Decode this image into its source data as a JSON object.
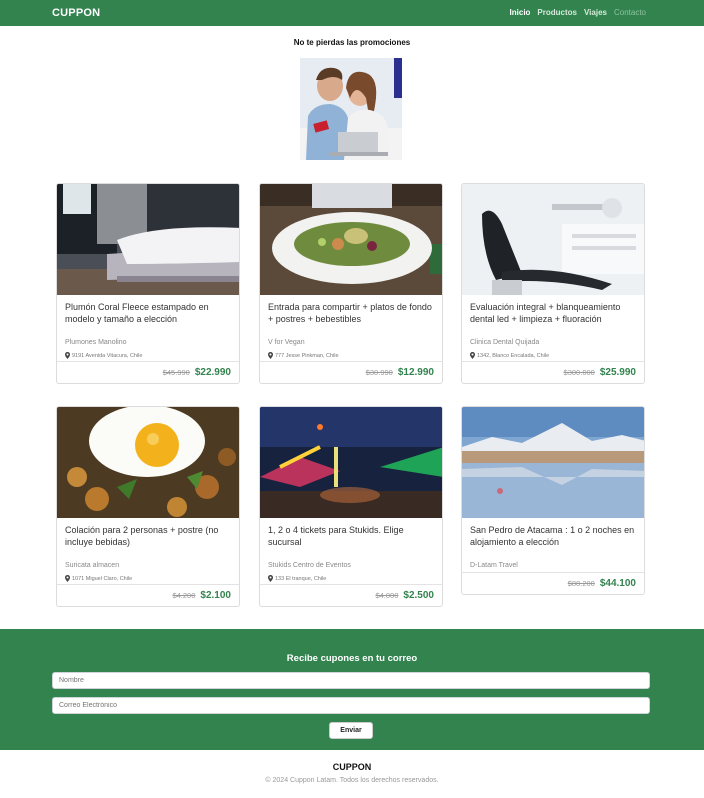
{
  "nav": {
    "brand": "CUPPON",
    "links": [
      {
        "label": "Inicio"
      },
      {
        "label": "Productos"
      },
      {
        "label": "Viajes"
      },
      {
        "label": "Contacto"
      }
    ]
  },
  "promo": {
    "title": "No te pierdas las promociones"
  },
  "deals": [
    {
      "title": "Plumón Coral Fleece estampado en modelo y tamaño a elección",
      "vendor": "Plumones Manolino",
      "address": "9191 Avenida Vitacura, Chile",
      "old_price": "$45.990",
      "new_price": "$22.990"
    },
    {
      "title": "Entrada para compartir + platos de fondo + postres + bebestibles",
      "vendor": "V for Vegan",
      "address": "777 Jesse Pinkman, Chile",
      "old_price": "$30.990",
      "new_price": "$12.990"
    },
    {
      "title": "Evaluación integral + blanqueamiento dental led + limpieza + fluoración",
      "vendor": "Clinica Dental Quijada",
      "address": "1342, Blanco Encalada, Chile",
      "old_price": "$300.000",
      "new_price": "$25.990"
    },
    {
      "title": "Colación para 2 personas + postre (no incluye bebidas)",
      "vendor": "Suricata almacen",
      "address": "1071 Miguel Claro, Chile",
      "old_price": "$4.200",
      "new_price": "$2.100"
    },
    {
      "title": "1, 2 o 4 tickets para Stukids. Elige sucursal",
      "vendor": "Stukids Centro de Eventos",
      "address": "133 El tranque, Chile",
      "old_price": "$4.000",
      "new_price": "$2.500"
    },
    {
      "title": "San Pedro de Atacama : 1 o 2 noches en alojamiento a elección",
      "vendor": "D-Latam Travel",
      "old_price": "$88.200",
      "new_price": "$44.100"
    }
  ],
  "newsletter": {
    "title": "Recibe cupones en tu correo",
    "name_placeholder": "Nombre",
    "email_placeholder": "Correo Electrónico",
    "submit_label": "Enviar"
  },
  "footer": {
    "brand": "CUPPON",
    "copyright": "© 2024 Cuppon Latam. Todos los derechos reservados."
  },
  "colors": {
    "brand_green": "#33834f",
    "price_green": "#33834f"
  }
}
